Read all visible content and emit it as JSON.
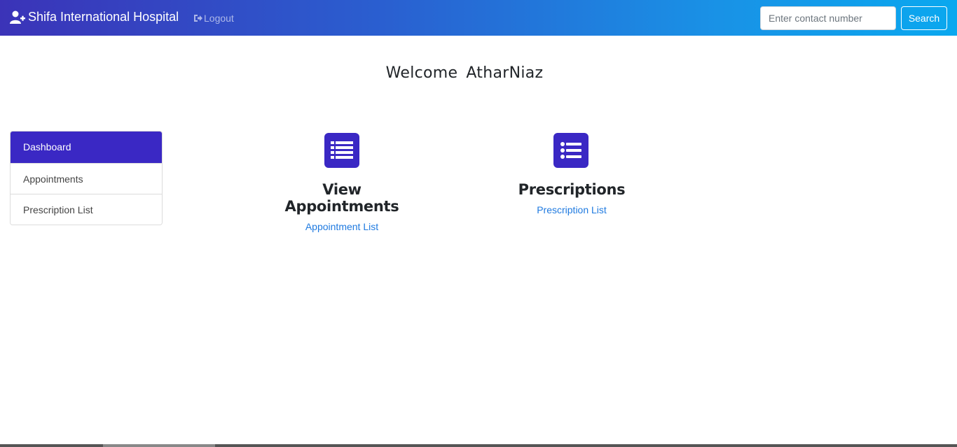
{
  "navbar": {
    "brand": "Shifa International Hospital",
    "brand_icon": "user-plus-icon",
    "logout_label": "Logout",
    "logout_icon": "sign-out-icon",
    "search_placeholder": "Enter contact number",
    "search_label": "Search",
    "gradient_start": "#3b33b8",
    "gradient_end": "#0aa8ef"
  },
  "welcome": {
    "greeting": "Welcome",
    "user": "AtharNiaz"
  },
  "sidebar": {
    "items": [
      {
        "label": "Dashboard",
        "active": true
      },
      {
        "label": "Appointments",
        "active": false
      },
      {
        "label": "Prescription List",
        "active": false
      }
    ],
    "active_color": "#3a28c4"
  },
  "cards": [
    {
      "title": "View Appointments",
      "link": "Appointment List",
      "icon": "list-icon"
    },
    {
      "title": "Prescriptions",
      "link": "Prescription List",
      "icon": "list-ul-icon"
    }
  ],
  "colors": {
    "accent": "#3a28c4",
    "link": "#1f7ae0"
  }
}
